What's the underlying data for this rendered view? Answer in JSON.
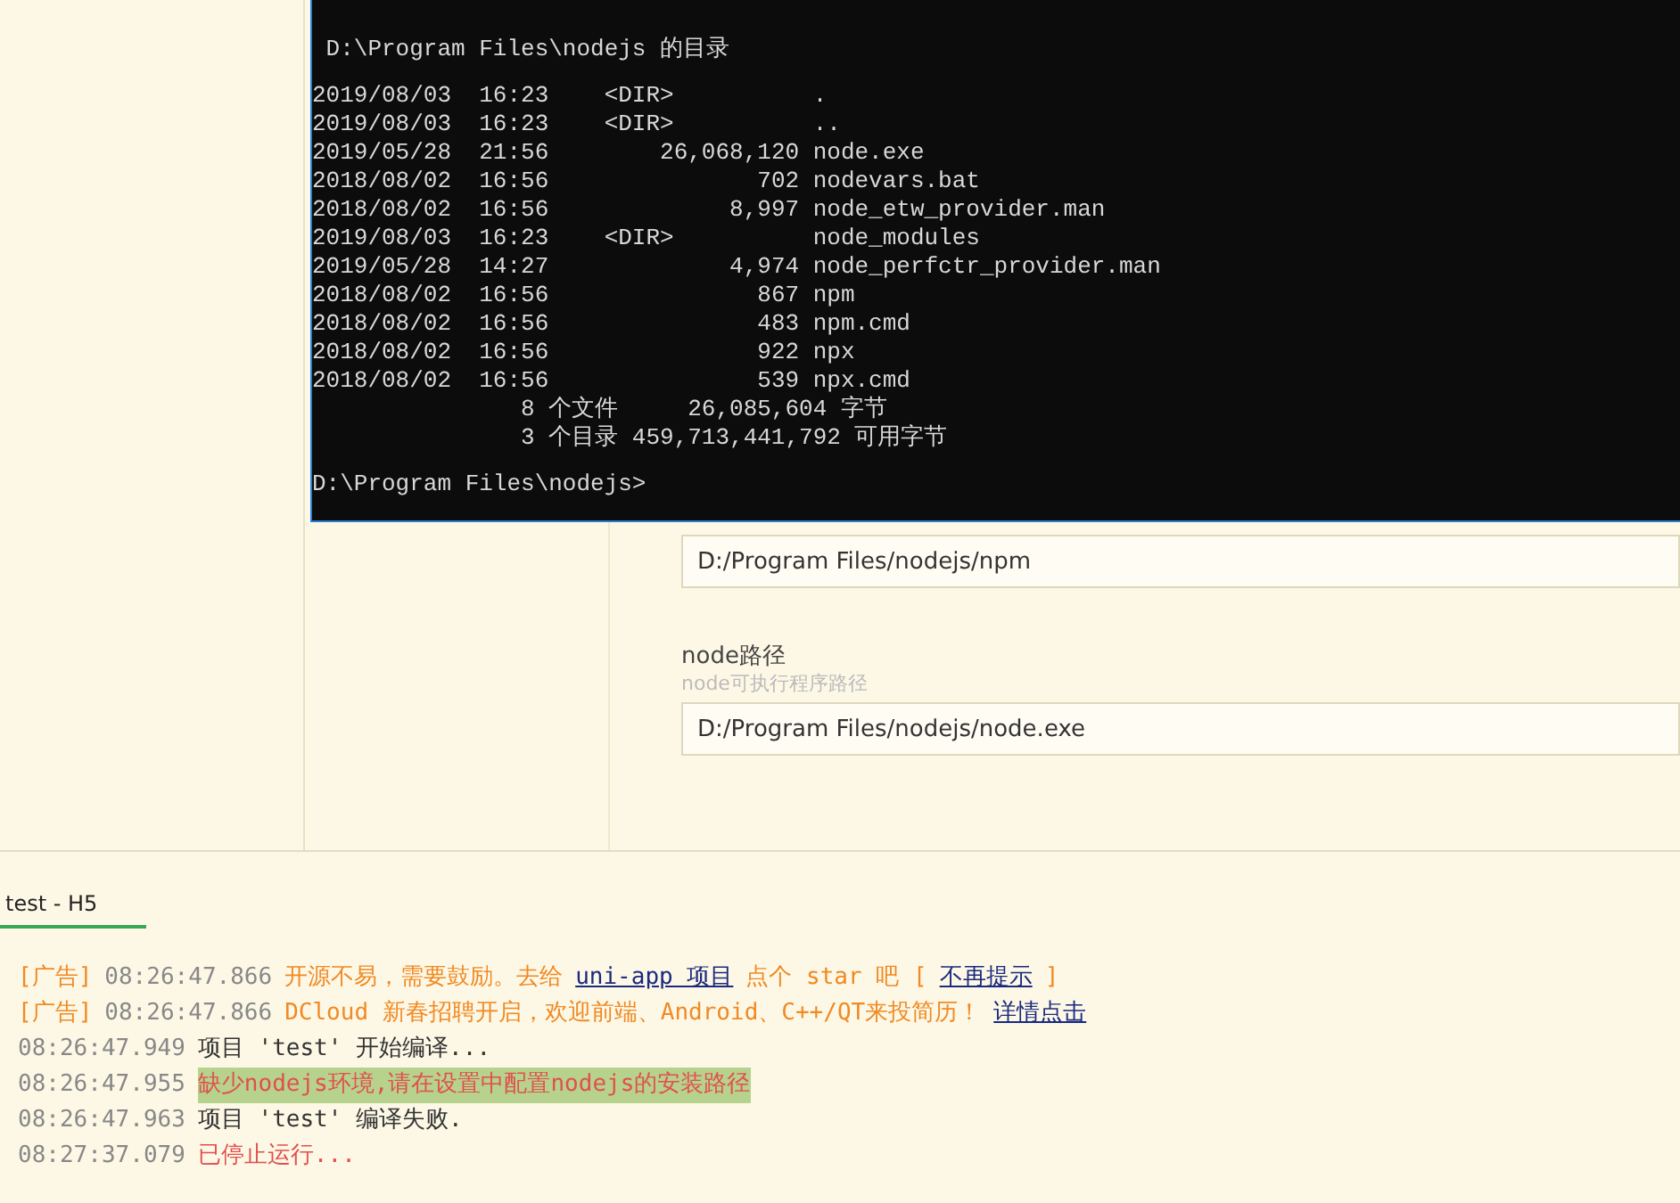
{
  "settings": {
    "fields": [
      {
        "value": "D:/Program Files/nodejs/npm"
      },
      {
        "label": "node路径",
        "hint": "node可执行程序路径",
        "value": "D:/Program Files/nodejs/node.exe"
      }
    ]
  },
  "terminal": {
    "heading": " D:\\Program Files\\nodejs 的目录",
    "lines": [
      "2019/08/03  16:23    <DIR>          .",
      "2019/08/03  16:23    <DIR>          ..",
      "2019/05/28  21:56        26,068,120 node.exe",
      "2018/08/02  16:56               702 nodevars.bat",
      "2018/08/02  16:56             8,997 node_etw_provider.man",
      "2019/08/03  16:23    <DIR>          node_modules",
      "2019/05/28  14:27             4,974 node_perfctr_provider.man",
      "2018/08/02  16:56               867 npm",
      "2018/08/02  16:56               483 npm.cmd",
      "2018/08/02  16:56               922 npx",
      "2018/08/02  16:56               539 npx.cmd",
      "               8 个文件     26,085,604 字节",
      "               3 个目录 459,713,441,792 可用字节"
    ],
    "prompt": "D:\\Program Files\\nodejs>"
  },
  "console": {
    "tabs": [
      {
        "label": "test - H5",
        "selected": true
      }
    ],
    "lines": [
      [
        {
          "kind": "ad",
          "text": "[广告]"
        },
        {
          "kind": "time",
          "text": "08:26:47.866"
        },
        {
          "kind": "ad",
          "text": "开源不易，需要鼓励。去给"
        },
        {
          "kind": "link",
          "text": "uni-app 项目"
        },
        {
          "kind": "ad",
          "text": "点个 star 吧 ["
        },
        {
          "kind": "link",
          "text": "不再提示"
        },
        {
          "kind": "ad",
          "text": "]"
        }
      ],
      [
        {
          "kind": "ad",
          "text": "[广告]"
        },
        {
          "kind": "time",
          "text": "08:26:47.866"
        },
        {
          "kind": "ad",
          "text": "DCloud 新春招聘开启，欢迎前端、Android、C++/QT来投简历！"
        },
        {
          "kind": "link",
          "text": "详情点击"
        }
      ],
      [
        {
          "kind": "time",
          "text": "08:26:47.949"
        },
        {
          "kind": "text",
          "text": "项目 'test' 开始编译..."
        }
      ],
      [
        {
          "kind": "time",
          "text": "08:26:47.955"
        },
        {
          "kind": "highlight",
          "text": "缺少nodejs环境,请在设置中配置nodejs的安装路径"
        }
      ],
      [
        {
          "kind": "time",
          "text": "08:26:47.963"
        },
        {
          "kind": "text",
          "text": "项目 'test' 编译失败."
        }
      ],
      [
        {
          "kind": "time",
          "text": "08:27:37.079"
        },
        {
          "kind": "error",
          "text": "已停止运行..."
        }
      ]
    ]
  }
}
